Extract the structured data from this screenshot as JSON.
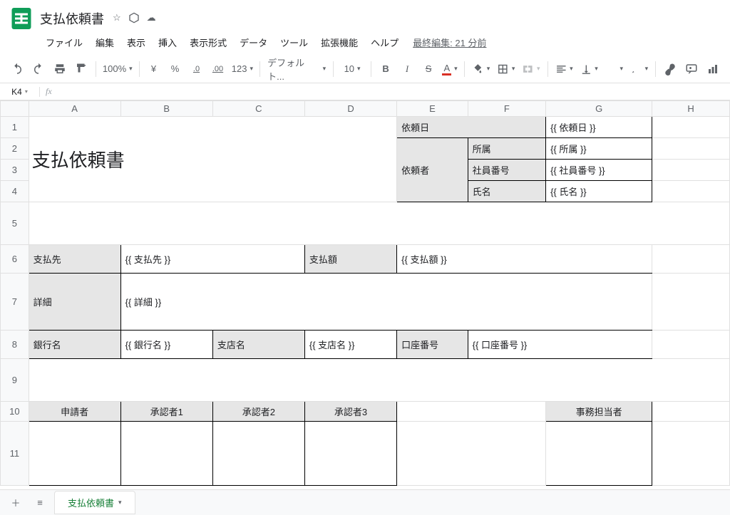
{
  "doc": {
    "title": "支払依頼書"
  },
  "menubar": [
    "ファイル",
    "編集",
    "表示",
    "挿入",
    "表示形式",
    "データ",
    "ツール",
    "拡張機能",
    "ヘルプ"
  ],
  "last_edit": "最終編集: 21 分前",
  "toolbar": {
    "zoom": "100%",
    "currency": "¥",
    "percent": "%",
    "dec_dec": ".0",
    "inc_dec": ".00",
    "numfmt": "123",
    "font": "デフォルト...",
    "size": "10",
    "bold": "B",
    "italic": "I",
    "strike": "S",
    "text_color": "A"
  },
  "formula": {
    "cell": "K4",
    "fx": "fx"
  },
  "cols": [
    "A",
    "B",
    "C",
    "D",
    "E",
    "F",
    "G",
    "H"
  ],
  "rows": [
    "1",
    "2",
    "3",
    "4",
    "5",
    "6",
    "7",
    "8",
    "9",
    "10",
    "11"
  ],
  "content": {
    "title": "支払依頼書",
    "req_date_lbl": "依頼日",
    "req_date_val": "{{ 依頼日 }}",
    "requester_lbl": "依頼者",
    "affil_lbl": "所属",
    "affil_val": "{{ 所属 }}",
    "emp_lbl": "社員番号",
    "emp_val": "{{ 社員番号 }}",
    "name_lbl": "氏名",
    "name_val": "{{ 氏名 }}",
    "payee_lbl": "支払先",
    "payee_val": "{{ 支払先 }}",
    "amount_lbl": "支払額",
    "amount_val": "{{ 支払額 }}",
    "detail_lbl": "詳細",
    "detail_val": "{{ 詳細 }}",
    "bank_lbl": "銀行名",
    "bank_val": "{{ 銀行名 }}",
    "branch_lbl": "支店名",
    "branch_val": "{{ 支店名 }}",
    "acct_lbl": "口座番号",
    "acct_val": "{{ 口座番号 }}",
    "applicant": "申請者",
    "approver1": "承認者1",
    "approver2": "承認者2",
    "approver3": "承認者3",
    "clerk": "事務担当者"
  },
  "sheet_tab": "支払依頼書"
}
